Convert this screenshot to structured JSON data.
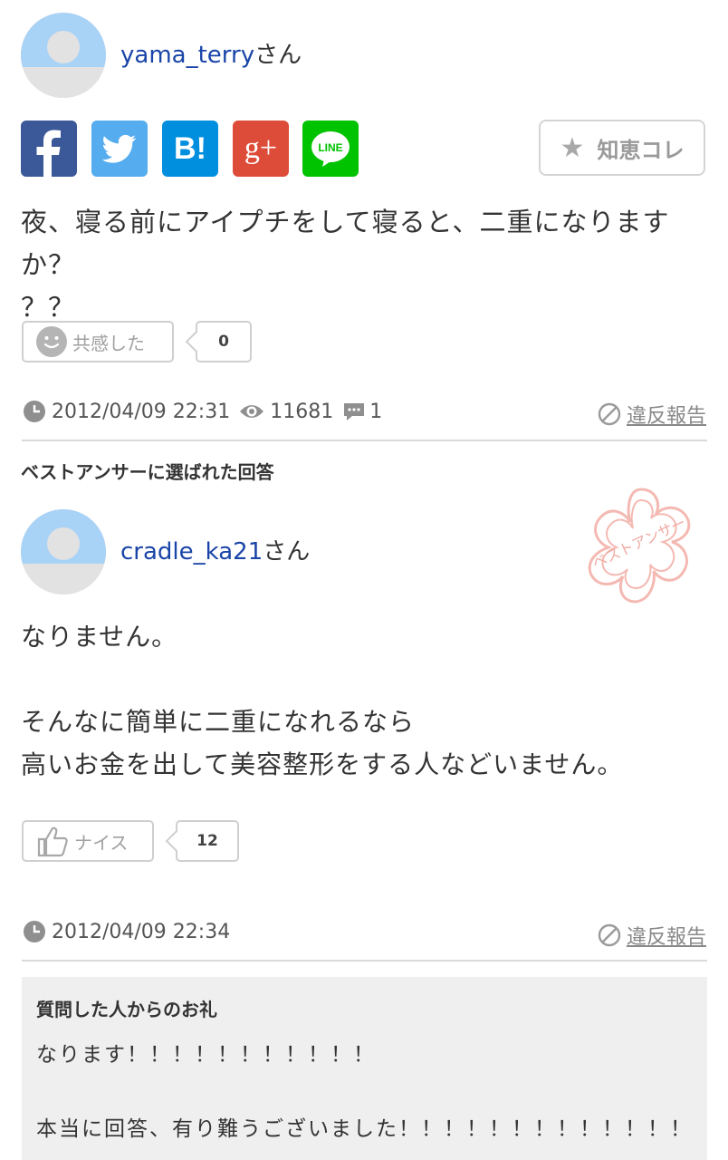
{
  "question": {
    "username": "yama_terry",
    "honorific": "さん",
    "share": {
      "facebook": "f",
      "twitter": "twitter-bird",
      "hatena": "B!",
      "googleplus": "g+",
      "line": "LINE"
    },
    "chie_button_label": "知恵コレ",
    "text_line1": "夜、寝る前にアイプチをして寝ると、二重になりますか？",
    "text_line2": "？？",
    "empathy_label": "共感した",
    "empathy_count": "0",
    "datetime": "2012/04/09 22:31",
    "views": "11681",
    "answers": "1",
    "report_label": "違反報告"
  },
  "best_answer": {
    "section_title": "ベストアンサーに選ばれた回答",
    "username": "cradle_ka21",
    "honorific": "さん",
    "stamp_text": "ベストアンサー",
    "line1": "なりません。",
    "line2": "そんなに簡単に二重になれるなら",
    "line3": "高いお金を出して美容整形をする人などいません。",
    "nice_label": "ナイス",
    "nice_count": "12",
    "datetime": "2012/04/09 22:34",
    "report_label": "違反報告"
  },
  "thanks": {
    "title": "質問した人からのお礼",
    "line1": "なります！！！！！！！！！！！",
    "line2": "本当に回答、有り難うございました！！！！！！！！！！！！！"
  },
  "colors": {
    "link": "#1a45a8",
    "facebook": "#3b5998",
    "twitter": "#55acee",
    "hatena": "#008fde",
    "googleplus": "#dd4b39",
    "line": "#00c300",
    "stamp": "#f4b9b2"
  }
}
